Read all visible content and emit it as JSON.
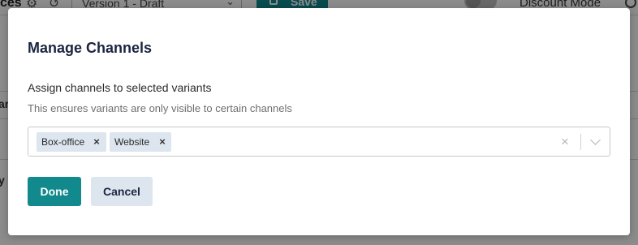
{
  "background": {
    "page_title_fragment": "ces",
    "version_select": "Version 1 - Draft",
    "save_label": "Save",
    "discount_mode_label": "Discount Mode",
    "side_fragment_1": "ar",
    "side_fragment_2": "y V"
  },
  "modal": {
    "title": "Manage Channels",
    "field_label": "Assign channels to selected variants",
    "help_text": "This ensures variants are only visible to certain channels",
    "selected_channels": [
      {
        "label": "Box-office"
      },
      {
        "label": "Website"
      }
    ],
    "remove_glyph": "×",
    "clear_glyph": "×",
    "done_label": "Done",
    "cancel_label": "Cancel"
  },
  "colors": {
    "primary": "#12898c",
    "chip_bg": "#dde5ef",
    "title": "#1b2540"
  },
  "icons": [
    "gear-icon",
    "history-icon",
    "chevron-down-icon",
    "save-icon",
    "close-icon",
    "chevron-down-icon"
  ]
}
